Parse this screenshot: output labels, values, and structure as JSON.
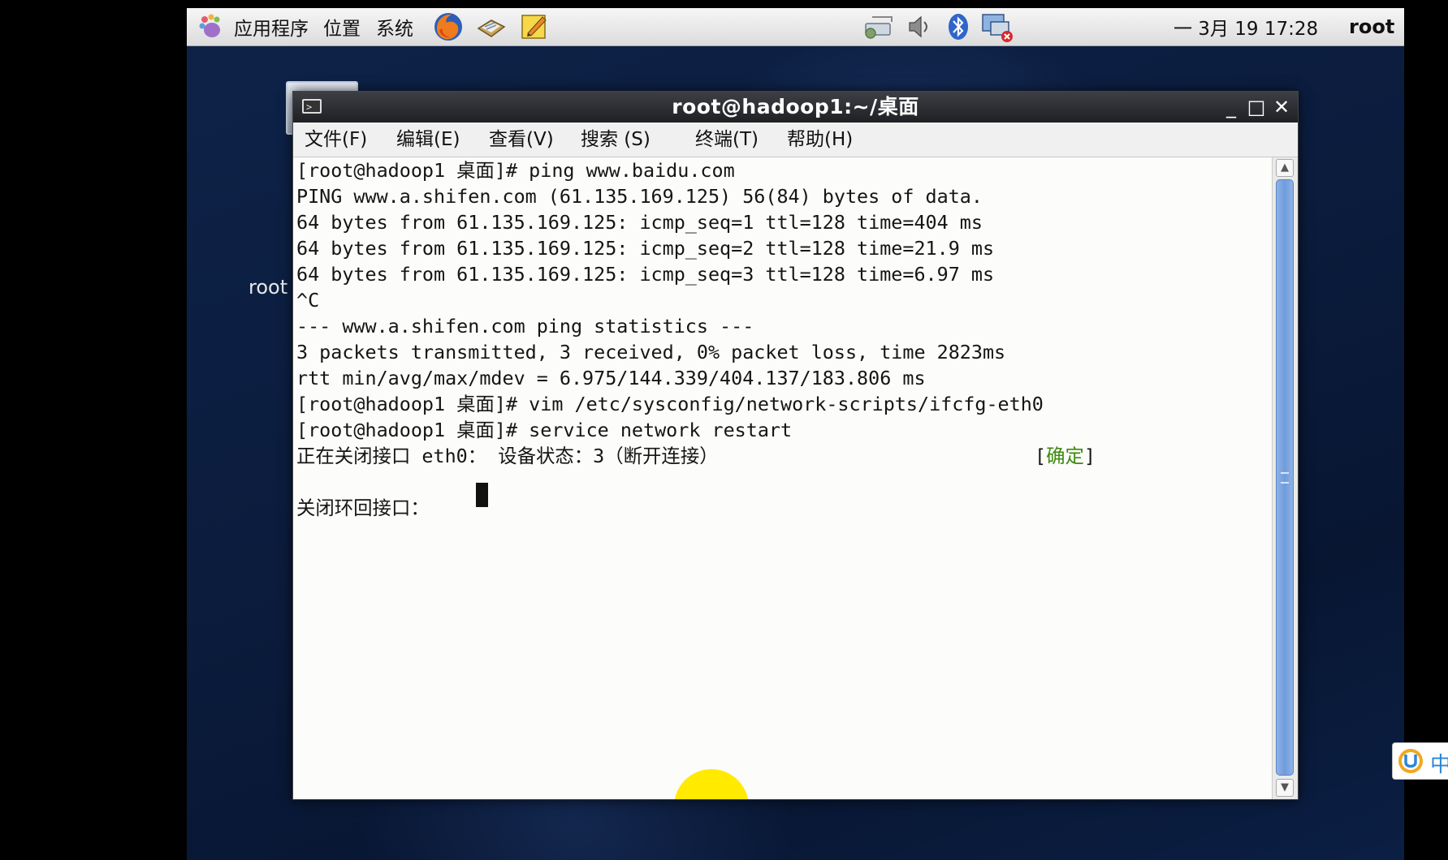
{
  "panel": {
    "menus": [
      "应用程序",
      "位置",
      "系统"
    ],
    "clock": "一 3月 19 17:28",
    "user": "root"
  },
  "desktop": {
    "icon_label": "root"
  },
  "window": {
    "title": "root@hadoop1:~/桌面",
    "menu": [
      "文件(F)",
      "编辑(E)",
      "查看(V)",
      "搜索 (S)",
      "终端(T)",
      "帮助(H)"
    ]
  },
  "terminal": {
    "lines": [
      "[root@hadoop1 桌面]# ping www.baidu.com",
      "PING www.a.shifen.com (61.135.169.125) 56(84) bytes of data.",
      "64 bytes from 61.135.169.125: icmp_seq=1 ttl=128 time=404 ms",
      "64 bytes from 61.135.169.125: icmp_seq=2 ttl=128 time=21.9 ms",
      "64 bytes from 61.135.169.125: icmp_seq=3 ttl=128 time=6.97 ms",
      "^C",
      "--- www.a.shifen.com ping statistics ---",
      "3 packets transmitted, 3 received, 0% packet loss, time 2823ms",
      "rtt min/avg/max/mdev = 6.975/144.339/404.137/183.806 ms",
      "[root@hadoop1 桌面]# vim /etc/sysconfig/network-scripts/ifcfg-eth0",
      "[root@hadoop1 桌面]# service network restart",
      "正在关闭接口 eth0： 设备状态：3（断开连接）",
      "",
      "关闭环回接口： "
    ],
    "ok_label": "确定",
    "ok_color": "#3d8a0e"
  },
  "ime": {
    "label": "中"
  }
}
